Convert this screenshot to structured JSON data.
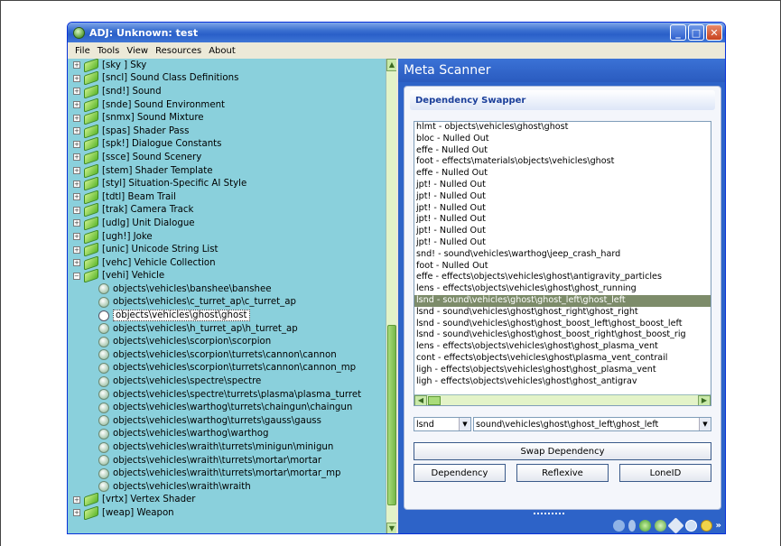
{
  "window": {
    "title": "ADJ: Unknown: test",
    "minimize": "_",
    "maximize": "□",
    "close": "✕"
  },
  "menu": [
    "File",
    "Tools",
    "View",
    "Resources",
    "About"
  ],
  "tree": {
    "tags_before": [
      "[sky ] Sky",
      "[sncl] Sound Class Definitions",
      "[snd!] Sound",
      "[snde] Sound Environment",
      "[snmx] Sound Mixture",
      "[spas] Shader Pass",
      "[spk!] Dialogue Constants",
      "[ssce] Sound Scenery",
      "[stem] Shader Template",
      "[styl] Situation-Specific AI Style",
      "[tdtl] Beam Trail",
      "[trak] Camera Track",
      "[udlg] Unit Dialogue",
      "[ugh!] Joke",
      "[unic] Unicode String List",
      "[vehc] Vehicle Collection"
    ],
    "expanded_tag": "[vehi] Vehicle",
    "children": [
      "objects\\vehicles\\banshee\\banshee",
      "objects\\vehicles\\c_turret_ap\\c_turret_ap",
      "objects\\vehicles\\ghost\\ghost",
      "objects\\vehicles\\h_turret_ap\\h_turret_ap",
      "objects\\vehicles\\scorpion\\scorpion",
      "objects\\vehicles\\scorpion\\turrets\\cannon\\cannon",
      "objects\\vehicles\\scorpion\\turrets\\cannon\\cannon_mp",
      "objects\\vehicles\\spectre\\spectre",
      "objects\\vehicles\\spectre\\turrets\\plasma\\plasma_turret",
      "objects\\vehicles\\warthog\\turrets\\chaingun\\chaingun",
      "objects\\vehicles\\warthog\\turrets\\gauss\\gauss",
      "objects\\vehicles\\warthog\\warthog",
      "objects\\vehicles\\wraith\\turrets\\minigun\\minigun",
      "objects\\vehicles\\wraith\\turrets\\mortar\\mortar",
      "objects\\vehicles\\wraith\\turrets\\mortar\\mortar_mp",
      "objects\\vehicles\\wraith\\wraith"
    ],
    "selected_child_index": 2,
    "tags_after": [
      "[vrtx] Vertex Shader",
      "[weap] Weapon"
    ],
    "expand_plus": "+",
    "expand_minus": "−"
  },
  "scanner": {
    "header": "Meta Scanner",
    "panel_title": "Dependency Swapper",
    "dependencies": [
      "hlmt - objects\\vehicles\\ghost\\ghost",
      "bloc - Nulled Out",
      "effe - Nulled Out",
      "foot - effects\\materials\\objects\\vehicles\\ghost",
      "effe - Nulled Out",
      "jpt! - Nulled Out",
      "jpt! - Nulled Out",
      "jpt! - Nulled Out",
      "jpt! - Nulled Out",
      "jpt! - Nulled Out",
      "jpt! - Nulled Out",
      "snd! - sound\\vehicles\\warthog\\jeep_crash_hard",
      "foot - Nulled Out",
      "effe - effects\\objects\\vehicles\\ghost\\antigravity_particles",
      "lens - effects\\objects\\vehicles\\ghost\\ghost_running",
      "lsnd - sound\\vehicles\\ghost\\ghost_left\\ghost_left",
      "lsnd - sound\\vehicles\\ghost\\ghost_right\\ghost_right",
      "lsnd - sound\\vehicles\\ghost\\ghost_boost_left\\ghost_boost_left",
      "lsnd - sound\\vehicles\\ghost\\ghost_boost_right\\ghost_boost_rig",
      "lens - effects\\objects\\vehicles\\ghost\\ghost_plasma_vent",
      "cont - effects\\objects\\vehicles\\ghost\\plasma_vent_contrail",
      "ligh - effects\\objects\\vehicles\\ghost\\ghost_plasma_vent",
      "ligh - effects\\objects\\vehicles\\ghost\\ghost_antigrav"
    ],
    "selected_dependency_index": 15,
    "type_select": "lsnd",
    "path_select": "sound\\vehicles\\ghost\\ghost_left\\ghost_left",
    "dropdown_arrow": "▼",
    "swap_button": "Swap Dependency",
    "dependency_button": "Dependency",
    "reflexive_button": "Reflexive",
    "loneid_button": "LoneID",
    "scroll_left": "◀",
    "scroll_right": "▶",
    "scroll_up": "▲",
    "scroll_down": "▼",
    "more": "»"
  },
  "colors": {
    "tree_bg": "#8ad0dc",
    "scanner_bg": "#2d63c8",
    "selection": "#7d8c6a"
  }
}
